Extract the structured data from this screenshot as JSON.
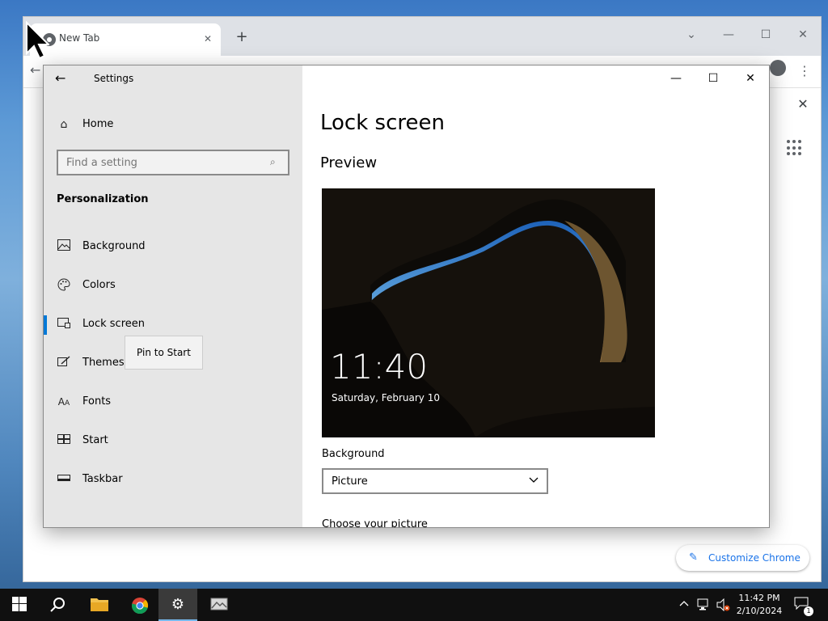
{
  "chrome": {
    "tab_title": "New Tab",
    "customize_label": "Customize Chrome"
  },
  "settings": {
    "window_title": "Settings",
    "home_label": "Home",
    "search_placeholder": "Find a setting",
    "section_heading": "Personalization",
    "nav_items": [
      {
        "label": "Background",
        "icon": "picture-icon",
        "active": false
      },
      {
        "label": "Colors",
        "icon": "palette-icon",
        "active": false
      },
      {
        "label": "Lock screen",
        "icon": "lock-screen-icon",
        "active": true
      },
      {
        "label": "Themes",
        "icon": "themes-icon",
        "active": false
      },
      {
        "label": "Fonts",
        "icon": "fonts-icon",
        "active": false
      },
      {
        "label": "Start",
        "icon": "start-icon",
        "active": false
      },
      {
        "label": "Taskbar",
        "icon": "taskbar-icon",
        "active": false
      }
    ],
    "tooltip": "Pin to Start",
    "page_title": "Lock screen",
    "preview_title": "Preview",
    "preview_time": "11:40",
    "preview_date": "Saturday, February 10",
    "background_label": "Background",
    "background_value": "Picture",
    "choose_picture_label": "Choose your picture"
  },
  "taskbar": {
    "time": "11:42 PM",
    "date": "2/10/2024",
    "notification_count": "1"
  },
  "colors": {
    "accent": "#0078d7",
    "chrome_blue": "#1a73e8",
    "taskbar": "#101010"
  }
}
